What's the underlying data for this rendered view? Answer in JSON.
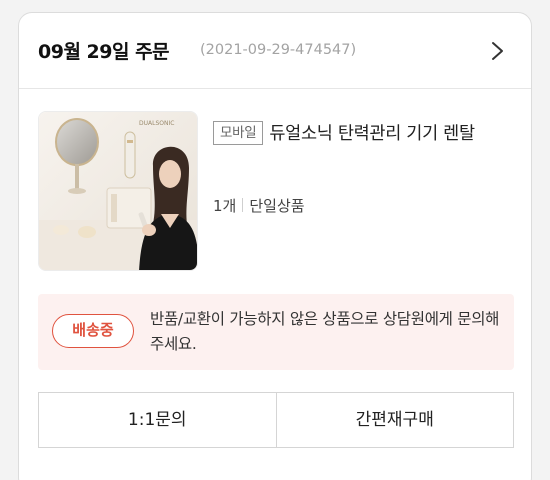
{
  "order": {
    "date_label": "09월 29일 주문",
    "order_number": "(2021-09-29-474547)"
  },
  "product": {
    "channel_badge": "모바일",
    "name": "듀얼소닉 탄력관리 기기 렌탈",
    "quantity": "1개",
    "product_type": "단일상품",
    "thumbnail_brand_text": "DUALSONIC"
  },
  "notice": {
    "status": "배송중",
    "message": "반품/교환이 가능하지 않은 상품으로 상담원에게 문의해주세요."
  },
  "actions": {
    "inquiry_label": "1:1문의",
    "reorder_label": "간편재구매"
  },
  "colors": {
    "accent_red": "#e0533f",
    "notice_bg": "#fdf1f0",
    "muted_text": "#a3a3a3"
  }
}
